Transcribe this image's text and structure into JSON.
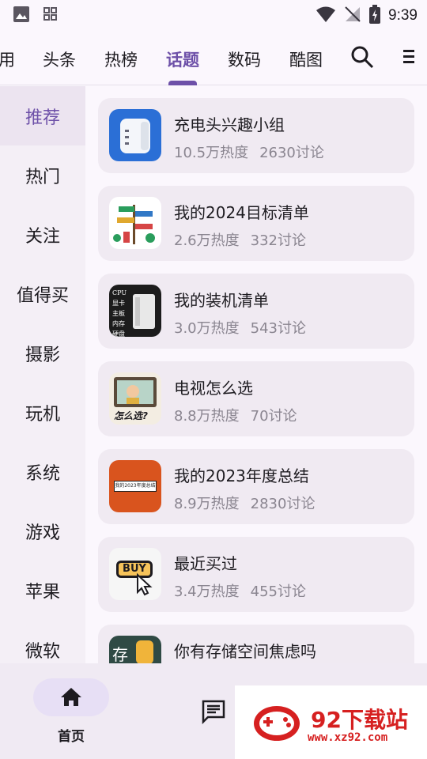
{
  "status_bar": {
    "time": "9:39"
  },
  "top_tabs": [
    {
      "label": "用"
    },
    {
      "label": "头条"
    },
    {
      "label": "热榜"
    },
    {
      "label": "话题"
    },
    {
      "label": "数码"
    },
    {
      "label": "酷图"
    }
  ],
  "active_tab": "话题",
  "categories": [
    {
      "label": "推荐"
    },
    {
      "label": "热门"
    },
    {
      "label": "关注"
    },
    {
      "label": "值得买"
    },
    {
      "label": "摄影"
    },
    {
      "label": "玩机"
    },
    {
      "label": "系统"
    },
    {
      "label": "游戏"
    },
    {
      "label": "苹果"
    },
    {
      "label": "微软"
    }
  ],
  "active_category": "推荐",
  "topics": [
    {
      "title": "充电头兴趣小组",
      "heat": "10.5万热度",
      "discuss": "2630讨论"
    },
    {
      "title": "我的2024目标清单",
      "heat": "2.6万热度",
      "discuss": "332讨论"
    },
    {
      "title": "我的装机清单",
      "heat": "3.0万热度",
      "discuss": "543讨论"
    },
    {
      "title": "电视怎么选",
      "heat": "8.8万热度",
      "discuss": "70讨论"
    },
    {
      "title": "我的2023年度总结",
      "heat": "8.9万热度",
      "discuss": "2830讨论"
    },
    {
      "title": "最近买过",
      "heat": "3.4万热度",
      "discuss": "455讨论"
    },
    {
      "title": "你有存储空间焦虑吗",
      "heat": "",
      "discuss": ""
    }
  ],
  "thumbs": {
    "t3_text": "CPU 显卡 主板 内存 硬盘",
    "t4_text": "怎么选?",
    "t5_text": "我的2023年度总结",
    "t6_text": "BUY",
    "t7_text": "存"
  },
  "bottom_nav": {
    "home_label": "首页"
  },
  "watermark": {
    "brand": "92下载站",
    "url": "www.xz92.com"
  },
  "colors": {
    "accent": "#6d50a8",
    "background": "#fbf7fd",
    "card": "#f0eaf2",
    "muted": "#8a8590"
  }
}
